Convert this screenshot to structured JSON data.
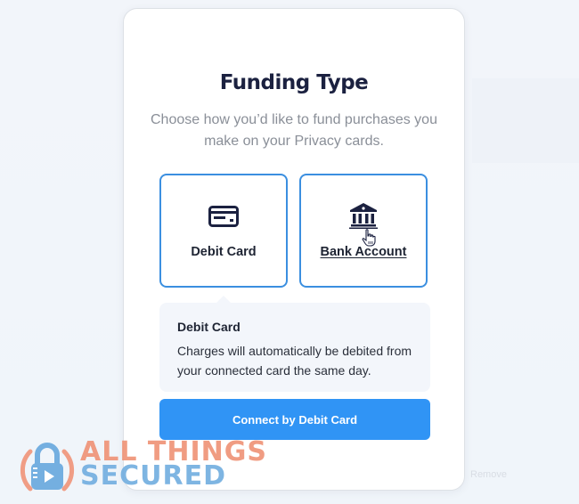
{
  "modal": {
    "title": "Funding Type",
    "subtitle": "Choose how you’d like to fund purchases you make on your Privacy cards.",
    "options": [
      {
        "label": "Debit Card",
        "icon": "credit-card-icon",
        "selected": true
      },
      {
        "label": "Bank Account",
        "icon": "bank-icon",
        "hovered": true
      }
    ],
    "info": {
      "title": "Debit Card",
      "text": "Charges will automatically be debited from your connected card the same day."
    },
    "connect_button": "Connect by Debit Card"
  },
  "colors": {
    "accent": "#3094f5",
    "option_border": "#3b8fe0",
    "title": "#1b2140",
    "subtitle": "#8a8f98",
    "info_bg": "#f3f6fb"
  },
  "watermark": {
    "line1": "ALL THINGS",
    "line2": "SECURED",
    "icon": "padlock-play-icon",
    "line1_color": "#ef9478",
    "line2_color": "#74afe0"
  },
  "background_text": "Remove"
}
